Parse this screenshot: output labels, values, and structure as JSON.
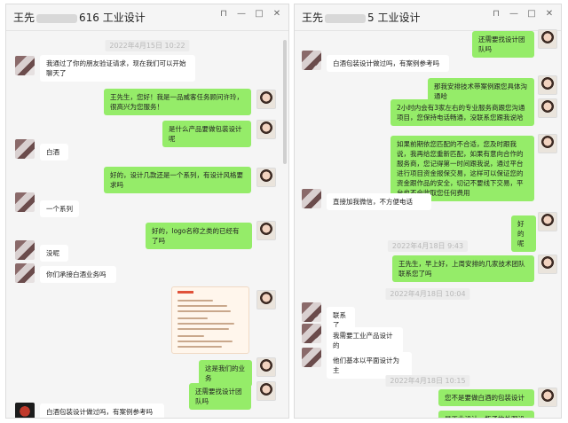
{
  "windows": [
    {
      "title_prefix": "王先",
      "title_suffix": "616 工业设计",
      "controls": [
        "⊓",
        "—",
        "□",
        "✕"
      ],
      "timestamps": [
        "2022年4月15日 10:22"
      ],
      "messages": [
        {
          "text": "我通过了你的朋友验证请求，现在我们可以开始聊天了"
        },
        {
          "text": "王先生，您好！我是一品威客任务顾问许玲，很高兴为您服务！"
        },
        {
          "text": "是什么产品要做包装设计呢"
        },
        {
          "text": "白酒"
        },
        {
          "text": "好的，设计几款还是一个系列，有设计风格要求吗"
        },
        {
          "text": "一个系列"
        },
        {
          "text": "好的，logo名称之类的已经有了吗"
        },
        {
          "text": "没呢"
        },
        {
          "text": "你们承接白酒业务吗"
        },
        {
          "text": "这是我们的业务"
        },
        {
          "text": "还需要找设计团队吗"
        },
        {
          "text": "白酒包装设计做过吗，有案例参考吗"
        }
      ]
    },
    {
      "title_prefix": "王先",
      "title_suffix": "5 工业设计",
      "controls": [
        "⊓",
        "—",
        "□",
        "✕"
      ],
      "timestamps": [
        "2022年4月18日 9:43",
        "2022年4月18日 10:04",
        "2022年4月18日 10:15"
      ],
      "messages": [
        {
          "text": "还需要找设计团队吗"
        },
        {
          "text": "白酒包装设计做过吗，有案例参考吗"
        },
        {
          "text": "那我安排技术带案例跟您具体沟通哈"
        },
        {
          "text": "2小时内会有3家左右的专业服务商跟您沟通项目，您保持电话畅通，没联系您跟我说哈"
        },
        {
          "text": "如果前期依您匹配的不合适，您及时跟我说，我再给您重新匹配，如果有意向合作的服务商，您记得第一时间跟我说，通过平台进行项目资金报保交易，这样可以保证您的资金跟作品的安全，切记不要线下交易，平台也不会收取您任何费用"
        },
        {
          "text": "直接加我微信，不方便电话"
        },
        {
          "text": "好的呢"
        },
        {
          "text": "王先生，早上好，上周安排的几家技术团队联系您了吗"
        },
        {
          "text": "联系了"
        },
        {
          "text": "我需要工业产品设计的"
        },
        {
          "text": "他们基本以平面设计为主"
        },
        {
          "text": "您不是要做白酒的包装设计"
        },
        {
          "text": "是工业设计，瓶子的外观设计吗"
        }
      ]
    }
  ]
}
